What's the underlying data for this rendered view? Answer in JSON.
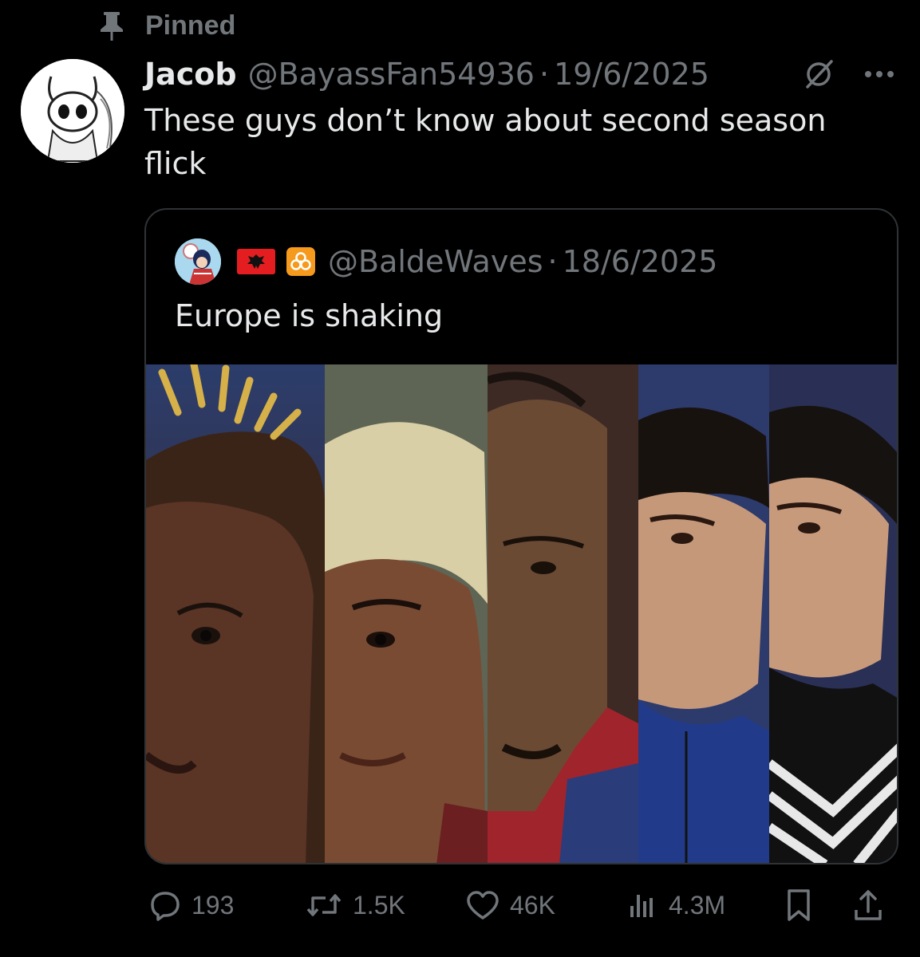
{
  "pinned": {
    "label": "Pinned",
    "icon": "pin-icon"
  },
  "tweet": {
    "author_name": "Jacob",
    "author_handle": "@BayassFan54936",
    "separator": "·",
    "date": "19/6/2025",
    "text": "These guys don’t know about second season flick"
  },
  "quote": {
    "handle": "@BaldeWaves",
    "separator": "·",
    "date": "18/6/2025",
    "text": "Europe is shaking",
    "emoji": [
      "albania-flag-icon",
      "biohazard-icon"
    ]
  },
  "actions": {
    "replies": "193",
    "reposts": "1.5K",
    "likes": "46K",
    "views": "4.3M"
  },
  "colors": {
    "background": "#000000",
    "text": "#e7e9ea",
    "muted": "#71767b",
    "border": "#2f3336"
  }
}
